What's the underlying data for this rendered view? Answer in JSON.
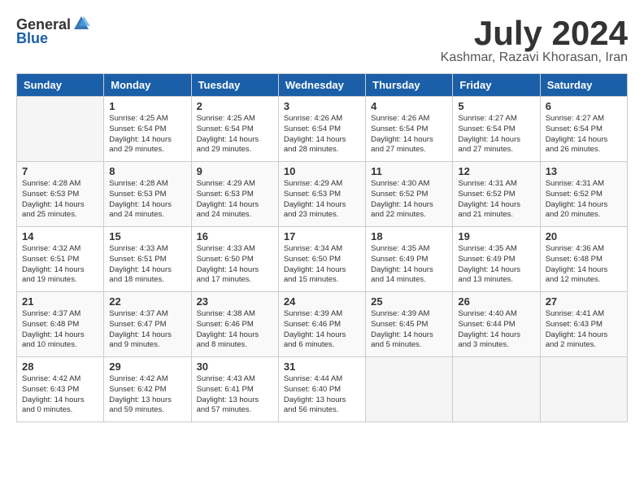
{
  "header": {
    "logo_general": "General",
    "logo_blue": "Blue",
    "month_title": "July 2024",
    "location": "Kashmar, Razavi Khorasan, Iran"
  },
  "weekdays": [
    "Sunday",
    "Monday",
    "Tuesday",
    "Wednesday",
    "Thursday",
    "Friday",
    "Saturday"
  ],
  "weeks": [
    [
      {
        "day": "",
        "sunrise": "",
        "sunset": "",
        "daylight": ""
      },
      {
        "day": "1",
        "sunrise": "Sunrise: 4:25 AM",
        "sunset": "Sunset: 6:54 PM",
        "daylight": "Daylight: 14 hours and 29 minutes."
      },
      {
        "day": "2",
        "sunrise": "Sunrise: 4:25 AM",
        "sunset": "Sunset: 6:54 PM",
        "daylight": "Daylight: 14 hours and 29 minutes."
      },
      {
        "day": "3",
        "sunrise": "Sunrise: 4:26 AM",
        "sunset": "Sunset: 6:54 PM",
        "daylight": "Daylight: 14 hours and 28 minutes."
      },
      {
        "day": "4",
        "sunrise": "Sunrise: 4:26 AM",
        "sunset": "Sunset: 6:54 PM",
        "daylight": "Daylight: 14 hours and 27 minutes."
      },
      {
        "day": "5",
        "sunrise": "Sunrise: 4:27 AM",
        "sunset": "Sunset: 6:54 PM",
        "daylight": "Daylight: 14 hours and 27 minutes."
      },
      {
        "day": "6",
        "sunrise": "Sunrise: 4:27 AM",
        "sunset": "Sunset: 6:54 PM",
        "daylight": "Daylight: 14 hours and 26 minutes."
      }
    ],
    [
      {
        "day": "7",
        "sunrise": "Sunrise: 4:28 AM",
        "sunset": "Sunset: 6:53 PM",
        "daylight": "Daylight: 14 hours and 25 minutes."
      },
      {
        "day": "8",
        "sunrise": "Sunrise: 4:28 AM",
        "sunset": "Sunset: 6:53 PM",
        "daylight": "Daylight: 14 hours and 24 minutes."
      },
      {
        "day": "9",
        "sunrise": "Sunrise: 4:29 AM",
        "sunset": "Sunset: 6:53 PM",
        "daylight": "Daylight: 14 hours and 24 minutes."
      },
      {
        "day": "10",
        "sunrise": "Sunrise: 4:29 AM",
        "sunset": "Sunset: 6:53 PM",
        "daylight": "Daylight: 14 hours and 23 minutes."
      },
      {
        "day": "11",
        "sunrise": "Sunrise: 4:30 AM",
        "sunset": "Sunset: 6:52 PM",
        "daylight": "Daylight: 14 hours and 22 minutes."
      },
      {
        "day": "12",
        "sunrise": "Sunrise: 4:31 AM",
        "sunset": "Sunset: 6:52 PM",
        "daylight": "Daylight: 14 hours and 21 minutes."
      },
      {
        "day": "13",
        "sunrise": "Sunrise: 4:31 AM",
        "sunset": "Sunset: 6:52 PM",
        "daylight": "Daylight: 14 hours and 20 minutes."
      }
    ],
    [
      {
        "day": "14",
        "sunrise": "Sunrise: 4:32 AM",
        "sunset": "Sunset: 6:51 PM",
        "daylight": "Daylight: 14 hours and 19 minutes."
      },
      {
        "day": "15",
        "sunrise": "Sunrise: 4:33 AM",
        "sunset": "Sunset: 6:51 PM",
        "daylight": "Daylight: 14 hours and 18 minutes."
      },
      {
        "day": "16",
        "sunrise": "Sunrise: 4:33 AM",
        "sunset": "Sunset: 6:50 PM",
        "daylight": "Daylight: 14 hours and 17 minutes."
      },
      {
        "day": "17",
        "sunrise": "Sunrise: 4:34 AM",
        "sunset": "Sunset: 6:50 PM",
        "daylight": "Daylight: 14 hours and 15 minutes."
      },
      {
        "day": "18",
        "sunrise": "Sunrise: 4:35 AM",
        "sunset": "Sunset: 6:49 PM",
        "daylight": "Daylight: 14 hours and 14 minutes."
      },
      {
        "day": "19",
        "sunrise": "Sunrise: 4:35 AM",
        "sunset": "Sunset: 6:49 PM",
        "daylight": "Daylight: 14 hours and 13 minutes."
      },
      {
        "day": "20",
        "sunrise": "Sunrise: 4:36 AM",
        "sunset": "Sunset: 6:48 PM",
        "daylight": "Daylight: 14 hours and 12 minutes."
      }
    ],
    [
      {
        "day": "21",
        "sunrise": "Sunrise: 4:37 AM",
        "sunset": "Sunset: 6:48 PM",
        "daylight": "Daylight: 14 hours and 10 minutes."
      },
      {
        "day": "22",
        "sunrise": "Sunrise: 4:37 AM",
        "sunset": "Sunset: 6:47 PM",
        "daylight": "Daylight: 14 hours and 9 minutes."
      },
      {
        "day": "23",
        "sunrise": "Sunrise: 4:38 AM",
        "sunset": "Sunset: 6:46 PM",
        "daylight": "Daylight: 14 hours and 8 minutes."
      },
      {
        "day": "24",
        "sunrise": "Sunrise: 4:39 AM",
        "sunset": "Sunset: 6:46 PM",
        "daylight": "Daylight: 14 hours and 6 minutes."
      },
      {
        "day": "25",
        "sunrise": "Sunrise: 4:39 AM",
        "sunset": "Sunset: 6:45 PM",
        "daylight": "Daylight: 14 hours and 5 minutes."
      },
      {
        "day": "26",
        "sunrise": "Sunrise: 4:40 AM",
        "sunset": "Sunset: 6:44 PM",
        "daylight": "Daylight: 14 hours and 3 minutes."
      },
      {
        "day": "27",
        "sunrise": "Sunrise: 4:41 AM",
        "sunset": "Sunset: 6:43 PM",
        "daylight": "Daylight: 14 hours and 2 minutes."
      }
    ],
    [
      {
        "day": "28",
        "sunrise": "Sunrise: 4:42 AM",
        "sunset": "Sunset: 6:43 PM",
        "daylight": "Daylight: 14 hours and 0 minutes."
      },
      {
        "day": "29",
        "sunrise": "Sunrise: 4:42 AM",
        "sunset": "Sunset: 6:42 PM",
        "daylight": "Daylight: 13 hours and 59 minutes."
      },
      {
        "day": "30",
        "sunrise": "Sunrise: 4:43 AM",
        "sunset": "Sunset: 6:41 PM",
        "daylight": "Daylight: 13 hours and 57 minutes."
      },
      {
        "day": "31",
        "sunrise": "Sunrise: 4:44 AM",
        "sunset": "Sunset: 6:40 PM",
        "daylight": "Daylight: 13 hours and 56 minutes."
      },
      {
        "day": "",
        "sunrise": "",
        "sunset": "",
        "daylight": ""
      },
      {
        "day": "",
        "sunrise": "",
        "sunset": "",
        "daylight": ""
      },
      {
        "day": "",
        "sunrise": "",
        "sunset": "",
        "daylight": ""
      }
    ]
  ]
}
